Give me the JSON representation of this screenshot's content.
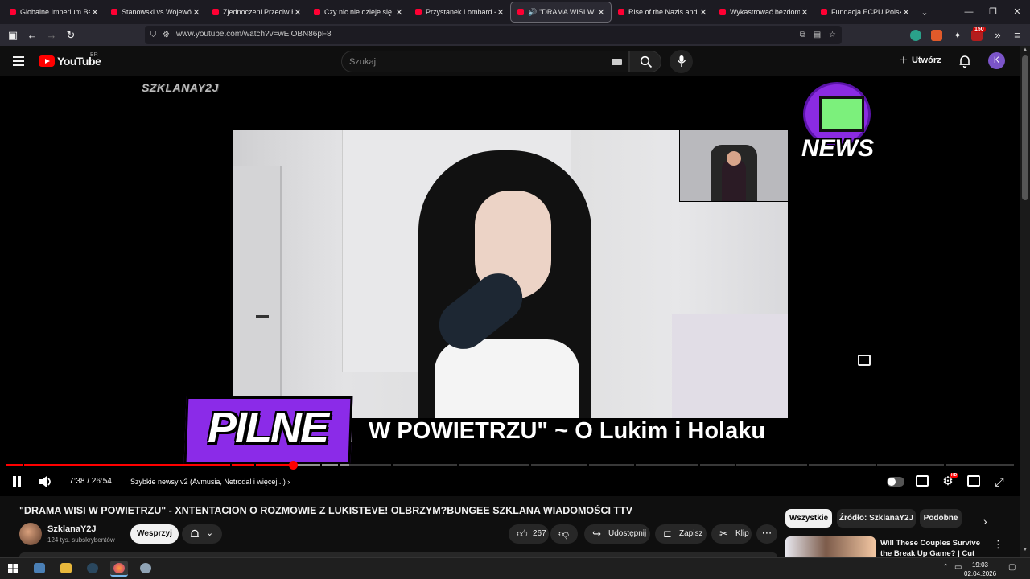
{
  "browser": {
    "tabs": [
      {
        "label": "Globalne Imperium Bezk"
      },
      {
        "label": "Stanowski vs Województ"
      },
      {
        "label": "Zjednoczeni Przeciw Ras"
      },
      {
        "label": "Czy nic nie dzieje się prz"
      },
      {
        "label": "Przystanek Lombard - Od"
      },
      {
        "label": "\"DRAMA WISI W PO"
      },
      {
        "label": "Rise of the Nazis and Ad"
      },
      {
        "label": "Wykastrować bezdomno"
      },
      {
        "label": "Fundacja ECPU Polska: k"
      }
    ],
    "active_tab_index": 5,
    "url": "www.youtube.com/watch?v=wEiOBN86pF8",
    "extension_badge": "150"
  },
  "youtube": {
    "logo_text": "YouTube",
    "region": "BR",
    "search_placeholder": "Szukaj",
    "create_label": "Utwórz",
    "avatar_letter": "K"
  },
  "player": {
    "watermark": "SZKLANAY2J",
    "news_logo_text": "NEWS",
    "banner_label": "PILNE",
    "ticker_text": "W POWIETRZU\" ~ O Lukim i Holaku",
    "current_time": "7:38",
    "duration": "26:54",
    "time_display": "7:38 / 26:54",
    "chapter_title": "Szybkie newsy v2 (Avmusia, Netrodal i więcej...)",
    "chapter_arrow": "›",
    "progress_fraction": 0.284,
    "buffered_fraction": 0.34,
    "quality_badge": "HD",
    "accent_color": "#ff0000"
  },
  "video": {
    "title": "\"DRAMA WISI W POWIETRZU\" - XNTENTACION O ROZMOWIE Z LUKISTEVE! OLBRZYM?BUNGEE SZKLANA WIADOMOŚCI TTV",
    "channel_name": "SzklanaY2J",
    "subscribers": "124 tys. subskrybentów",
    "support_label": "Wesprzyj",
    "like_count": "267",
    "share_label": "Udostępnij",
    "save_label": "Zapisz",
    "clip_label": "Klip",
    "more_label": "⋯"
  },
  "sidebar": {
    "chips": [
      "Wszystkie",
      "Źródło: SzklanaY2J",
      "Podobne"
    ],
    "active_chip_index": 0,
    "related": [
      {
        "title": "Will These Couples Survive the Break Up Game? | Cut"
      }
    ]
  },
  "taskbar": {
    "time": "19:03",
    "date": "02.04.2026"
  }
}
